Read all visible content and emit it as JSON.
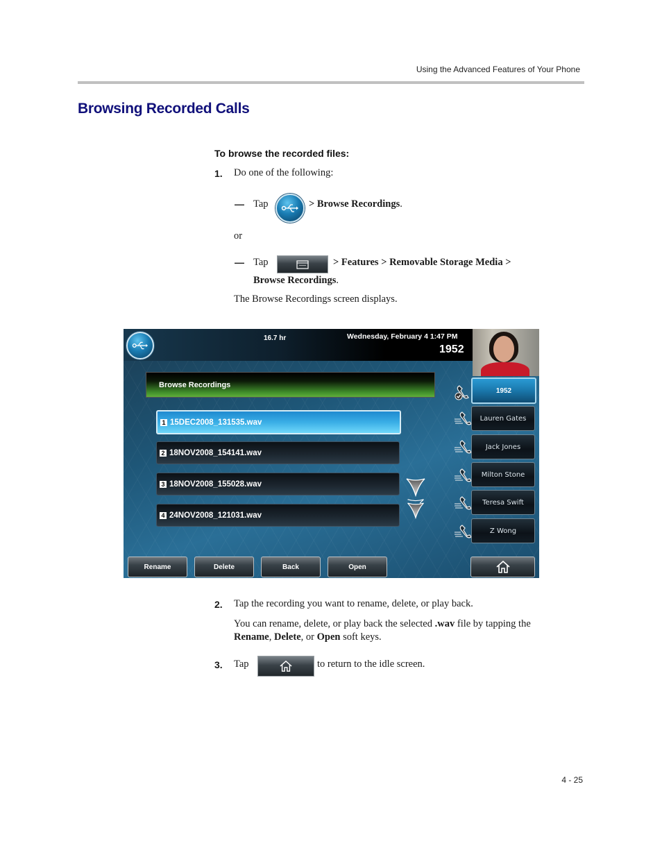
{
  "header": {
    "running_title": "Using the Advanced Features of Your Phone"
  },
  "section": {
    "title": "Browsing Recorded Calls"
  },
  "procedure": {
    "heading": "To browse the recorded files:",
    "step1": {
      "number": "1.",
      "text": "Do one of the following:",
      "option_a": {
        "dash": "—",
        "tap": "Tap",
        "path": "> Browse Recordings",
        "end": "."
      },
      "or": "or",
      "option_b": {
        "dash": "—",
        "tap": "Tap",
        "path": "> Features > Removable Storage Media >",
        "path2": "Browse Recordings",
        "end": "."
      },
      "result": "The Browse Recordings screen displays."
    },
    "step2": {
      "number": "2.",
      "text": "Tap the recording you want to rename, delete, or play back.",
      "note_pre": "You can rename, delete, or play back the selected ",
      "note_bold1": ".wav",
      "note_mid": " file by tapping the",
      "note_bold2": "Rename",
      "note_sep1": ", ",
      "note_bold3": "Delete",
      "note_sep2": ", or ",
      "note_bold4": "Open",
      "note_end": " soft keys."
    },
    "step3": {
      "number": "3.",
      "tap": "Tap",
      "text": "to return to the idle screen."
    }
  },
  "phone_screen": {
    "storage_remaining": "16.7 hr",
    "datetime": "Wednesday, February 4  1:47 PM",
    "extension": "1952",
    "screen_title": "Browse Recordings",
    "recordings": [
      {
        "index": "1",
        "name": "15DEC2008_131535.wav",
        "selected": true
      },
      {
        "index": "2",
        "name": "18NOV2008_154141.wav",
        "selected": false
      },
      {
        "index": "3",
        "name": "18NOV2008_155028.wav",
        "selected": false
      },
      {
        "index": "4",
        "name": "24NOV2008_121031.wav",
        "selected": false
      }
    ],
    "line_keys": [
      {
        "label": "1952",
        "active": true
      },
      {
        "label": "Lauren Gates",
        "active": false
      },
      {
        "label": "Jack Jones",
        "active": false
      },
      {
        "label": "Milton Stone",
        "active": false
      },
      {
        "label": "Teresa Swift",
        "active": false
      },
      {
        "label": "Z Wong",
        "active": false
      }
    ],
    "soft_keys": [
      "Rename",
      "Delete",
      "Back",
      "Open"
    ],
    "icons": {
      "usb": "usb-icon",
      "home": "home-icon",
      "scroll_down": "chevron-down-icon",
      "page_down": "double-chevron-down-icon"
    }
  },
  "footer": {
    "page_number": "4 - 25"
  }
}
